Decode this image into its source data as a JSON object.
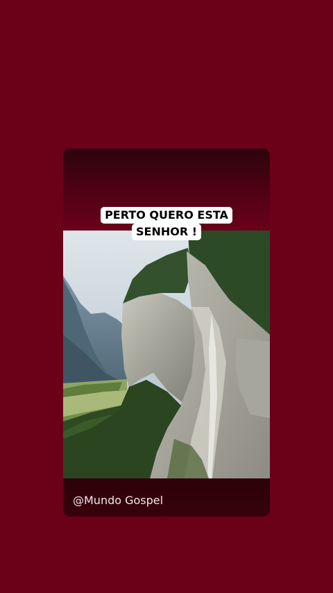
{
  "post": {
    "caption_lines": [
      "PERTO QUERO ESTA",
      "SENHOR !"
    ],
    "username": "@Mundo Gospel"
  },
  "colors": {
    "background": "#6b0019",
    "card_dark": "#2d0207",
    "caption_bg": "#ffffff"
  }
}
